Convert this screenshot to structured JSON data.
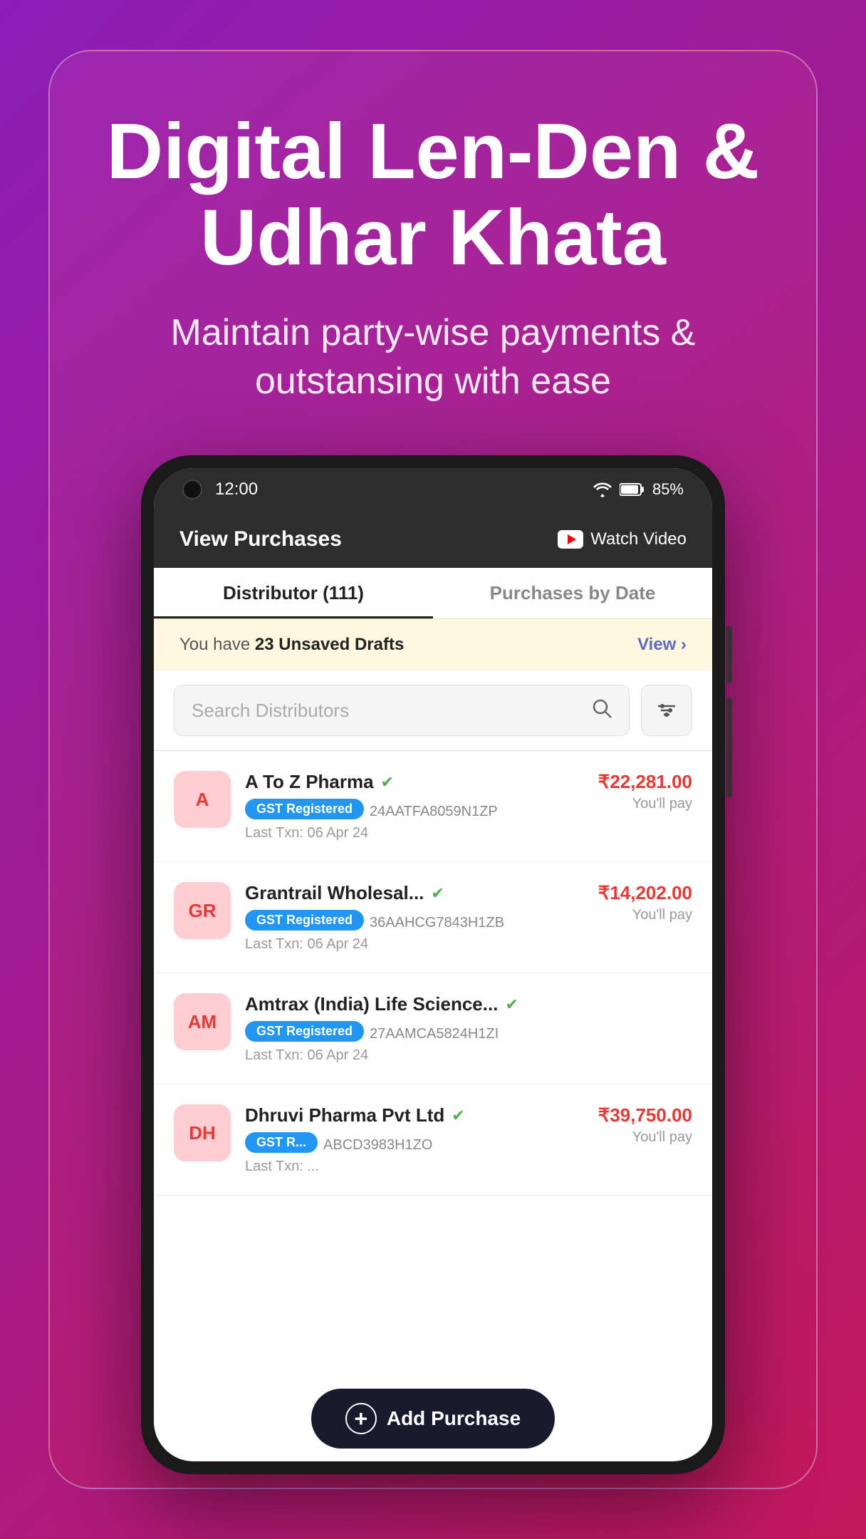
{
  "background": {
    "gradient_start": "#8B1DB8",
    "gradient_end": "#C2185B"
  },
  "hero": {
    "title": "Digital Len-Den\n& Udhar Khata",
    "subtitle": "Maintain party-wise payments &\noutstansing with ease"
  },
  "phone": {
    "status_bar": {
      "time": "12:00",
      "battery": "85%"
    },
    "header": {
      "title": "View Purchases",
      "watch_video_label": "Watch Video"
    },
    "tabs": [
      {
        "label": "Distributor (111)",
        "active": true
      },
      {
        "label": "Purchases by Date",
        "active": false
      }
    ],
    "draft_banner": {
      "prefix": "You have ",
      "highlight": "23 Unsaved Drafts",
      "action": "View ›"
    },
    "search": {
      "placeholder": "Search Distributors"
    },
    "distributors": [
      {
        "initials": "A",
        "name": "A To Z Pharma",
        "verified": true,
        "gst_badge": "GST Registered",
        "gst_number": "24AATFA8059N1ZP",
        "last_txn": "Last Txn: 06 Apr 24",
        "amount": "₹22,281.00",
        "amount_label": "You'll pay"
      },
      {
        "initials": "GR",
        "name": "Grantrail Wholesal...",
        "verified": true,
        "gst_badge": "GST Registered",
        "gst_number": "36AAHCG7843H1ZB",
        "last_txn": "Last Txn: 06 Apr 24",
        "amount": "₹14,202.00",
        "amount_label": "You'll pay"
      },
      {
        "initials": "AM",
        "name": "Amtrax (India) Life Science...",
        "verified": true,
        "gst_badge": "GST Registered",
        "gst_number": "27AAMCA5824H1ZI",
        "last_txn": "Last Txn: 06 Apr 24",
        "amount": "",
        "amount_label": ""
      },
      {
        "initials": "DH",
        "name": "Dhruvi Pharma Pvt Ltd",
        "verified": true,
        "gst_badge": "GST R...",
        "gst_number": "ABCD3983H1ZO",
        "last_txn": "Last Txn: ...",
        "amount": "₹39,750.00",
        "amount_label": "You'll pay"
      }
    ],
    "fab": {
      "label": "Add Purchase"
    }
  }
}
